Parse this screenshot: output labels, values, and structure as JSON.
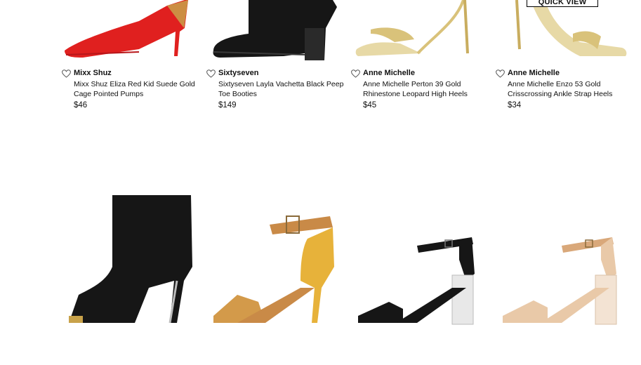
{
  "quick_view_label": "QUICK VIEW",
  "products": [
    {
      "brand": "Mixx Shuz",
      "name": "Mixx Shuz Eliza Red Kid Suede Gold Cage Pointed Pumps",
      "price": "$46"
    },
    {
      "brand": "Sixtyseven",
      "name": "Sixtyseven Layla Vachetta Black Peep Toe Booties",
      "price": "$149"
    },
    {
      "brand": "Anne Michelle",
      "name": "Anne Michelle Perton 39 Gold Rhinestone Leopard High Heels",
      "price": "$45"
    },
    {
      "brand": "Anne Michelle",
      "name": "Anne Michelle Enzo 53 Gold Crisscrossing Ankle Strap Heels",
      "price": "$34"
    }
  ],
  "colors": {
    "red": "#e0201f",
    "black": "#161616",
    "gold": "#d9c27a",
    "mustard": "#e7b23a",
    "tan": "#c98a47",
    "nude": "#e9c9a8"
  },
  "icons": [
    "heart-icon"
  ]
}
